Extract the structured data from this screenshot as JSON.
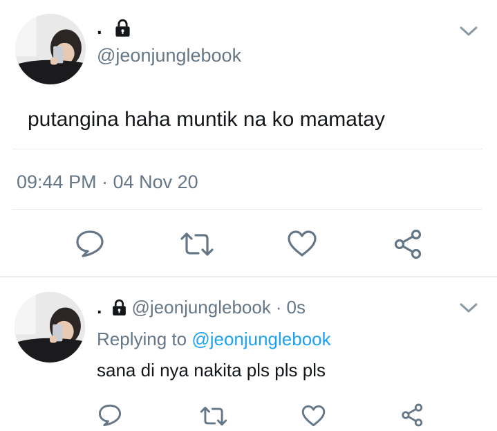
{
  "main_tweet": {
    "display_name": ".",
    "handle": "@jeonjunglebook",
    "text": "putangina haha muntik na ko mamatay",
    "timestamp": "09:44 PM · 04 Nov 20",
    "icons": [
      "lock-icon",
      "chevron-down-icon",
      "reply-icon",
      "retweet-icon",
      "like-icon",
      "share-icon"
    ]
  },
  "reply_tweet": {
    "display_name": ".",
    "handle": "@jeonjunglebook",
    "time_sep": "·",
    "time": "0s",
    "replying_prefix": "Replying to",
    "replying_handle": "@jeonjunglebook",
    "text": "sana di nya nakita pls pls pls",
    "icons": [
      "lock-icon",
      "chevron-down-icon",
      "reply-icon",
      "retweet-icon",
      "like-icon",
      "share-icon"
    ]
  },
  "colors": {
    "text": "#14171a",
    "muted": "#657786",
    "link": "#1da1f2",
    "divider": "#e6ecf0"
  }
}
